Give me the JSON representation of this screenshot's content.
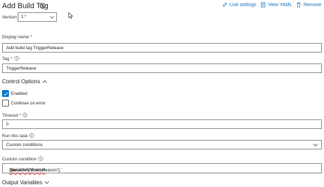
{
  "header": {
    "title": "Add Build Tag",
    "link_settings": "Link settings",
    "view_yaml": "View YAML",
    "remove": "Remove",
    "accent_color": "#106ebe"
  },
  "version": {
    "label": "Version",
    "value": "1.*"
  },
  "display_name": {
    "label": "Display name",
    "required_marker": "*",
    "value": "Add build tag TriggerRelease"
  },
  "tag": {
    "label": "Tag",
    "required_marker": "*",
    "value": "TriggerRelease"
  },
  "control_options": {
    "label": "Control Options",
    "enabled": {
      "label": "Enabled",
      "checked": true
    },
    "continue_on_error": {
      "label": "Continue on error",
      "checked": false
    },
    "timeout": {
      "label": "Timeout",
      "required_marker": "*",
      "value": "0"
    },
    "run_this_task": {
      "label": "Run this task",
      "value": "Custom conditions"
    },
    "custom_condition": {
      "label": "Custom condition",
      "value_prefix": "ne",
      "value_rest": "(variables['Build.Reason'],'",
      "value_squiggle": "CheckInShelveset",
      "value_suffix": "')"
    }
  },
  "output_variables": {
    "label": "Output Variables"
  },
  "icons": [
    "info-icon",
    "link-icon",
    "yaml-icon",
    "trash-icon",
    "chevron-down-icon",
    "chevron-up-icon",
    "checkmark-icon",
    "mouse-cursor-icon"
  ]
}
